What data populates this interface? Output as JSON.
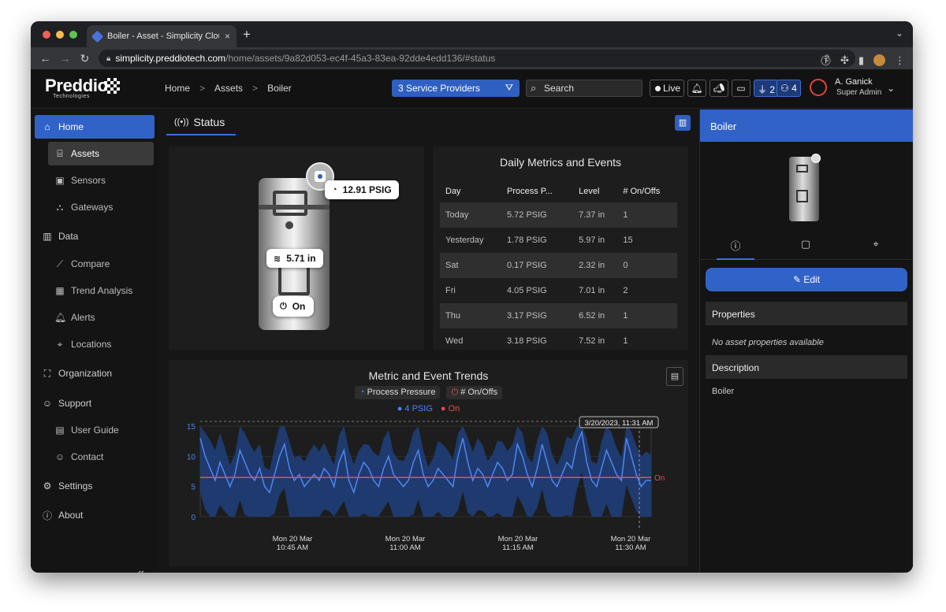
{
  "browser": {
    "tab_title": "Boiler - Asset - Simplicity Clou",
    "tab_close": "×",
    "new_tab": "+",
    "url_host": "simplicity.preddiotech.com",
    "url_path": "/home/assets/9a82d053-ec4f-45a3-83ea-92dde4edd136/#status",
    "colors": {
      "red": "#ee5f57",
      "yellow": "#f5bd4f",
      "green": "#5fc452"
    }
  },
  "header": {
    "logo": "Preddio",
    "logo_sub": "Technologies",
    "breadcrumb": [
      "Home",
      "Assets",
      "Boiler"
    ],
    "breadcrumb_sep": ">",
    "service_providers": "3 Service Providers",
    "search_placeholder": "Search",
    "live_label": "Live",
    "plug_count": "2",
    "people_count": "4",
    "user_name": "A. Ganick",
    "user_role": "Super Admin"
  },
  "sidebar": {
    "home": "Home",
    "assets": "Assets",
    "sensors": "Sensors",
    "gateways": "Gateways",
    "data": "Data",
    "compare": "Compare",
    "trend_analysis": "Trend Analysis",
    "alerts": "Alerts",
    "locations": "Locations",
    "organization": "Organization",
    "support": "Support",
    "user_guide": "User Guide",
    "contact": "Contact",
    "settings": "Settings",
    "about": "About",
    "collapse": "«"
  },
  "main": {
    "status_tab": "Status",
    "asset": {
      "pressure": "12.91 PSIG",
      "level": "5.71 in",
      "state": "On"
    },
    "metrics": {
      "title": "Daily Metrics and Events",
      "headers": [
        "Day",
        "Process P...",
        "Level",
        "# On/Offs"
      ],
      "rows": [
        [
          "Today",
          "5.72 PSIG",
          "7.37 in",
          "1"
        ],
        [
          "Yesterday",
          "1.78 PSIG",
          "5.97 in",
          "15"
        ],
        [
          "Sat",
          "0.17 PSIG",
          "2.32 in",
          "0"
        ],
        [
          "Fri",
          "4.05 PSIG",
          "7.01 in",
          "2"
        ],
        [
          "Thu",
          "3.17 PSIG",
          "6.52 in",
          "1"
        ],
        [
          "Wed",
          "3.18 PSIG",
          "7.52 in",
          "1"
        ]
      ]
    },
    "trend": {
      "title": "Metric and Event Trends",
      "legend_pressure": "Process Pressure",
      "legend_onoffs": "# On/Offs",
      "series_psig": "4 PSIG",
      "series_on": "On"
    }
  },
  "chart_data": {
    "type": "line",
    "title": "Metric and Event Trends",
    "ylim": [
      0,
      15
    ],
    "yticks": [
      0,
      5,
      10,
      15
    ],
    "xticks": [
      "Mon 20 Mar\n10:45 AM",
      "Mon 20 Mar\n11:00 AM",
      "Mon 20 Mar\n11:15 AM",
      "Mon 20 Mar\n11:30 AM"
    ],
    "tooltip": "3/20/2023, 11:31 AM",
    "on_label": "On",
    "on_level": 6.5,
    "series": [
      {
        "name": "4 PSIG",
        "color": "#4d83ea",
        "values": [
          13,
          10,
          8,
          6,
          9,
          7,
          5,
          7,
          11,
          9,
          7,
          6,
          8,
          5,
          4,
          7,
          10,
          12,
          8,
          6,
          7,
          5,
          6,
          7,
          6,
          8,
          7,
          5,
          9,
          11,
          6,
          4,
          7,
          9,
          8,
          6,
          5,
          8,
          10,
          7,
          6,
          5,
          6,
          9,
          11,
          7,
          5,
          6,
          8,
          7,
          6,
          5,
          10,
          13,
          9,
          6,
          8,
          7,
          5,
          7,
          9,
          8,
          6,
          7,
          12,
          10,
          7,
          5,
          8,
          12,
          9,
          6,
          5,
          7,
          9,
          8,
          12,
          14,
          9,
          6,
          5,
          8,
          11,
          9,
          7,
          6,
          13,
          10,
          7,
          5,
          6,
          6
        ]
      },
      {
        "name": "On",
        "color": "#e24d4d",
        "values": [
          6.5,
          6.5
        ]
      }
    ]
  },
  "right_panel": {
    "title": "Boiler",
    "edit_label": "Edit",
    "properties_header": "Properties",
    "properties_value": "No asset properties available",
    "description_header": "Description",
    "description_value": "Boiler"
  }
}
